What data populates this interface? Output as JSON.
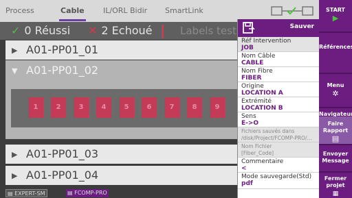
{
  "tabs": [
    "Process",
    "Cable",
    "IL/ORL Bidir",
    "SmartLink"
  ],
  "status": {
    "ok_label": "0 Réussi",
    "fail_label": "2 Echoué",
    "labels_text": "Labels test"
  },
  "rows": {
    "r1": "A01-PP01_01",
    "r2": "A01-PP01_02",
    "r3": "A01-PP01_03",
    "r4": "A01-PP01_04"
  },
  "fibers": [
    "1",
    "2",
    "3",
    "4",
    "5",
    "6",
    "7",
    "8",
    "9"
  ],
  "footer": {
    "expert": "EXPERT-SM",
    "fcomp": "FCOMP-PRO"
  },
  "panel": {
    "save_label": "Sauver",
    "ref_label": "Réf Intervention",
    "ref_value": "JOB",
    "cable_label": "Nom Câble",
    "cable_value": "CABLE",
    "fiber_label": "Nom Fibre",
    "fiber_value": "FIBER",
    "origin_label": "Origine",
    "origin_value": "LOCATION A",
    "end_label": "Extrémité",
    "end_value": "LOCATION B",
    "dir_label": "Sens",
    "dir_value": "E->O",
    "files_label": "Fichiers sauvés dans",
    "files_value": "/disk/Project/FCOMP-PRO/...",
    "filename_label": "Nom Fichier",
    "filename_value": "[Fiber_Code]",
    "comment_label": "Commentaire",
    "comment_value": "<",
    "mode_label": "Mode sauvegarde(Std)",
    "mode_value": "pdf"
  },
  "sidebar": {
    "start": "START",
    "references": "Références",
    "menu": "Menu",
    "navigator": "Navigateur de fichiers",
    "report": "Faire Rapport",
    "send": "Envoyer Message",
    "close": "Fermer projet"
  },
  "colors": {
    "accent": "#6b1e80",
    "pass": "#4fbf3f",
    "fail": "#d9364a"
  }
}
